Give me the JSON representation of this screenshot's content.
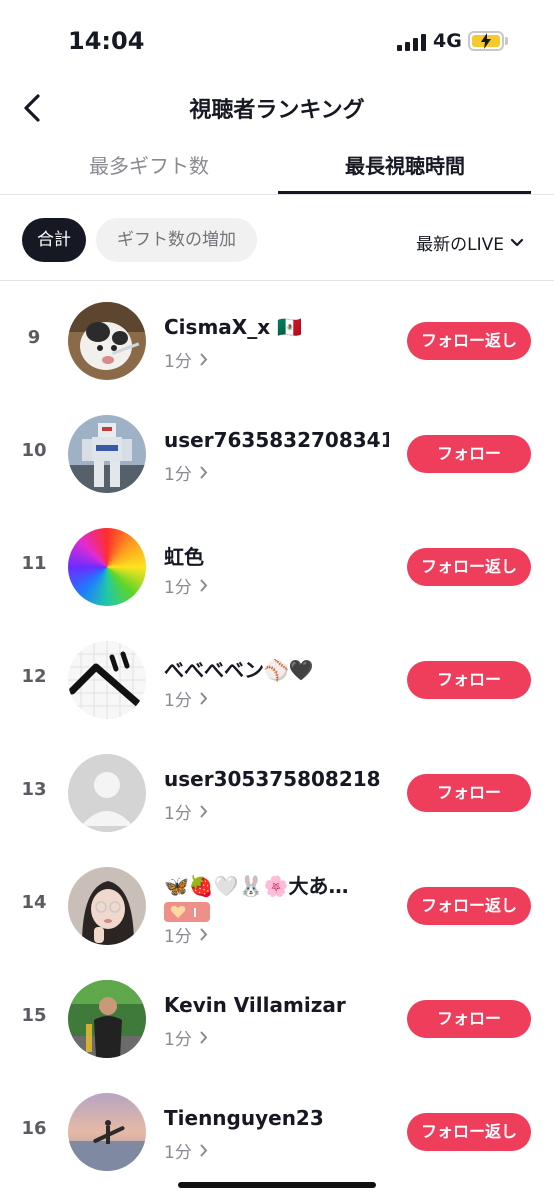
{
  "status_bar": {
    "time": "14:04",
    "network": "4G"
  },
  "header": {
    "title": "視聴者ランキング"
  },
  "tabs": [
    {
      "label": "最多ギフト数",
      "active": false
    },
    {
      "label": "最長視聴時間",
      "active": true
    }
  ],
  "filters": {
    "total": "合計",
    "gift_increase": "ギフト数の増加",
    "latest": "最新のLIVE"
  },
  "viewers": [
    {
      "rank": "9",
      "name": "CismaX_x 🇲🇽",
      "duration": "1分",
      "action": "フォロー返し"
    },
    {
      "rank": "10",
      "name": "user7635832708341",
      "duration": "1分",
      "action": "フォロー"
    },
    {
      "rank": "11",
      "name": "虹色",
      "duration": "1分",
      "action": "フォロー返し"
    },
    {
      "rank": "12",
      "name": "べべべベン⚾🖤",
      "duration": "1分",
      "action": "フォロー"
    },
    {
      "rank": "13",
      "name": "user305375808218",
      "duration": "1分",
      "action": "フォロー"
    },
    {
      "rank": "14",
      "name": "🦋🍓🤍🐰🌸大あ…",
      "duration": "1分",
      "action": "フォロー返し",
      "badge": "heart-level-badge"
    },
    {
      "rank": "15",
      "name": "Kevin Villamizar",
      "duration": "1分",
      "action": "フォロー"
    },
    {
      "rank": "16",
      "name": "Tiennguyen23",
      "duration": "1分",
      "action": "フォロー返し"
    }
  ],
  "colors": {
    "follow_button": "#ee3e5c",
    "active_chip": "#161823",
    "inactive_chip": "#f1f1f2"
  }
}
